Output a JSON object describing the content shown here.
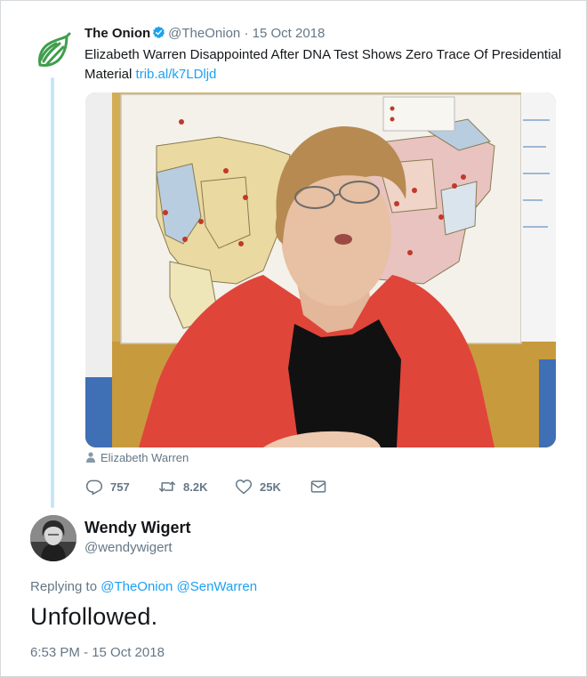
{
  "parent_tweet": {
    "author_name": "The Onion",
    "author_handle": "@TheOnion",
    "separator": "·",
    "date": "15 Oct 2018",
    "text": "Elizabeth Warren Disappointed After DNA Test Shows Zero Trace Of Presidential Material ",
    "link": "trib.al/k7LDljd",
    "media_credit": "Elizabeth Warren",
    "reply_count": "757",
    "retweet_count": "8.2K",
    "like_count": "25K"
  },
  "reply_tweet": {
    "author_name": "Wendy Wigert",
    "author_handle": "@wendywigert",
    "replying_prefix": "Replying to ",
    "mention_1": "@TheOnion",
    "mention_2": "@SenWarren",
    "text": "Unfollowed.",
    "timestamp": "6:53 PM - 15 Oct 2018"
  },
  "icons": {
    "onion_logo": "onion-logo-icon",
    "verified": "verified-badge-icon",
    "person": "person-icon",
    "reply": "reply-icon",
    "retweet": "retweet-icon",
    "like": "heart-icon",
    "dm": "envelope-icon"
  },
  "colors": {
    "link": "#1da1f2",
    "secondary_text": "#657786",
    "onion_green": "#3f9e4d",
    "thread_line": "#c4e6fb"
  }
}
